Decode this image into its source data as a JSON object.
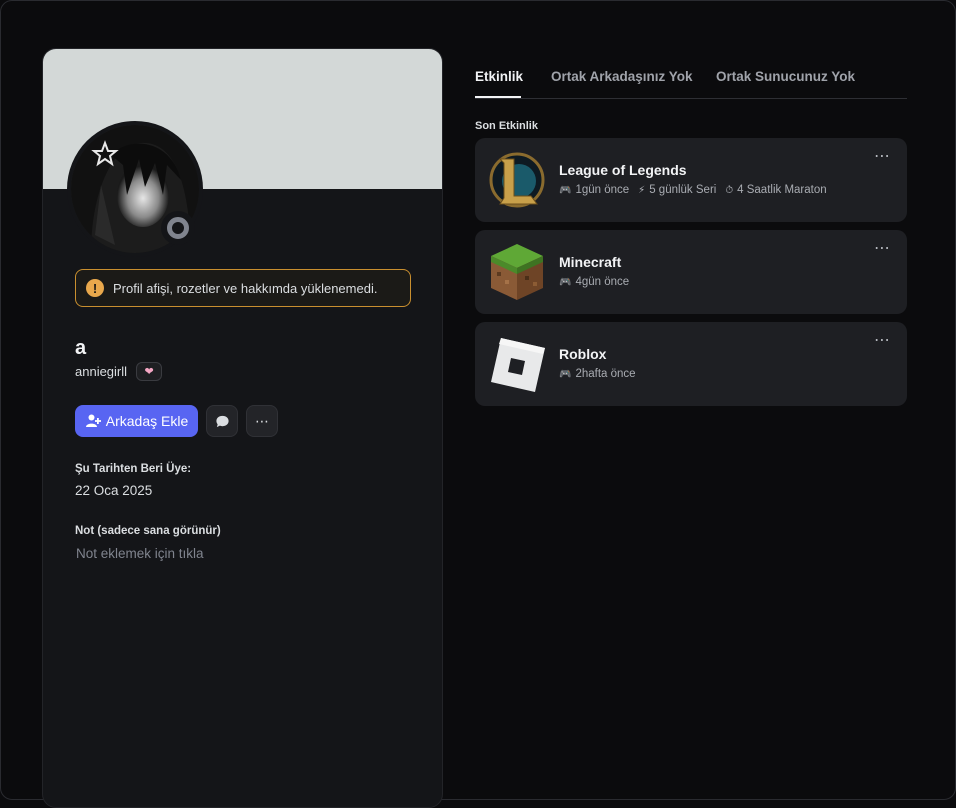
{
  "profile": {
    "warning": "Profil afişi, rozetler ve hakkımda yüklenemedi.",
    "display_name": "a",
    "username": "anniegirll",
    "add_friend_label": "Arkadaş Ekle",
    "member_since_label": "Şu Tarihten Beri Üye:",
    "member_since_value": "22 Oca 2025",
    "note_label": "Not (sadece sana görünür)",
    "note_placeholder": "Not eklemek için tıkla",
    "status": "offline"
  },
  "tabs": [
    {
      "label": "Etkinlik",
      "active": true
    },
    {
      "label": "Ortak Arkadaşınız Yok",
      "active": false
    },
    {
      "label": "Ortak Sunucunuz Yok",
      "active": false
    }
  ],
  "recent_label": "Son Etkinlik",
  "activities": [
    {
      "title": "League of Legends",
      "meta": [
        {
          "icon": "gamepad-icon",
          "text": "1gün önce"
        },
        {
          "icon": "lightning-icon",
          "text": "5 günlük Seri"
        },
        {
          "icon": "stopwatch-icon",
          "text": "4 Saatlik Maraton"
        }
      ]
    },
    {
      "title": "Minecraft",
      "meta": [
        {
          "icon": "gamepad-icon",
          "text": "4gün önce"
        }
      ]
    },
    {
      "title": "Roblox",
      "meta": [
        {
          "icon": "gamepad-icon",
          "text": "2hafta önce"
        }
      ]
    }
  ],
  "colors": {
    "accent": "#5865f2",
    "warning_border": "#c98f2f",
    "banner": "#d3d8d7"
  }
}
